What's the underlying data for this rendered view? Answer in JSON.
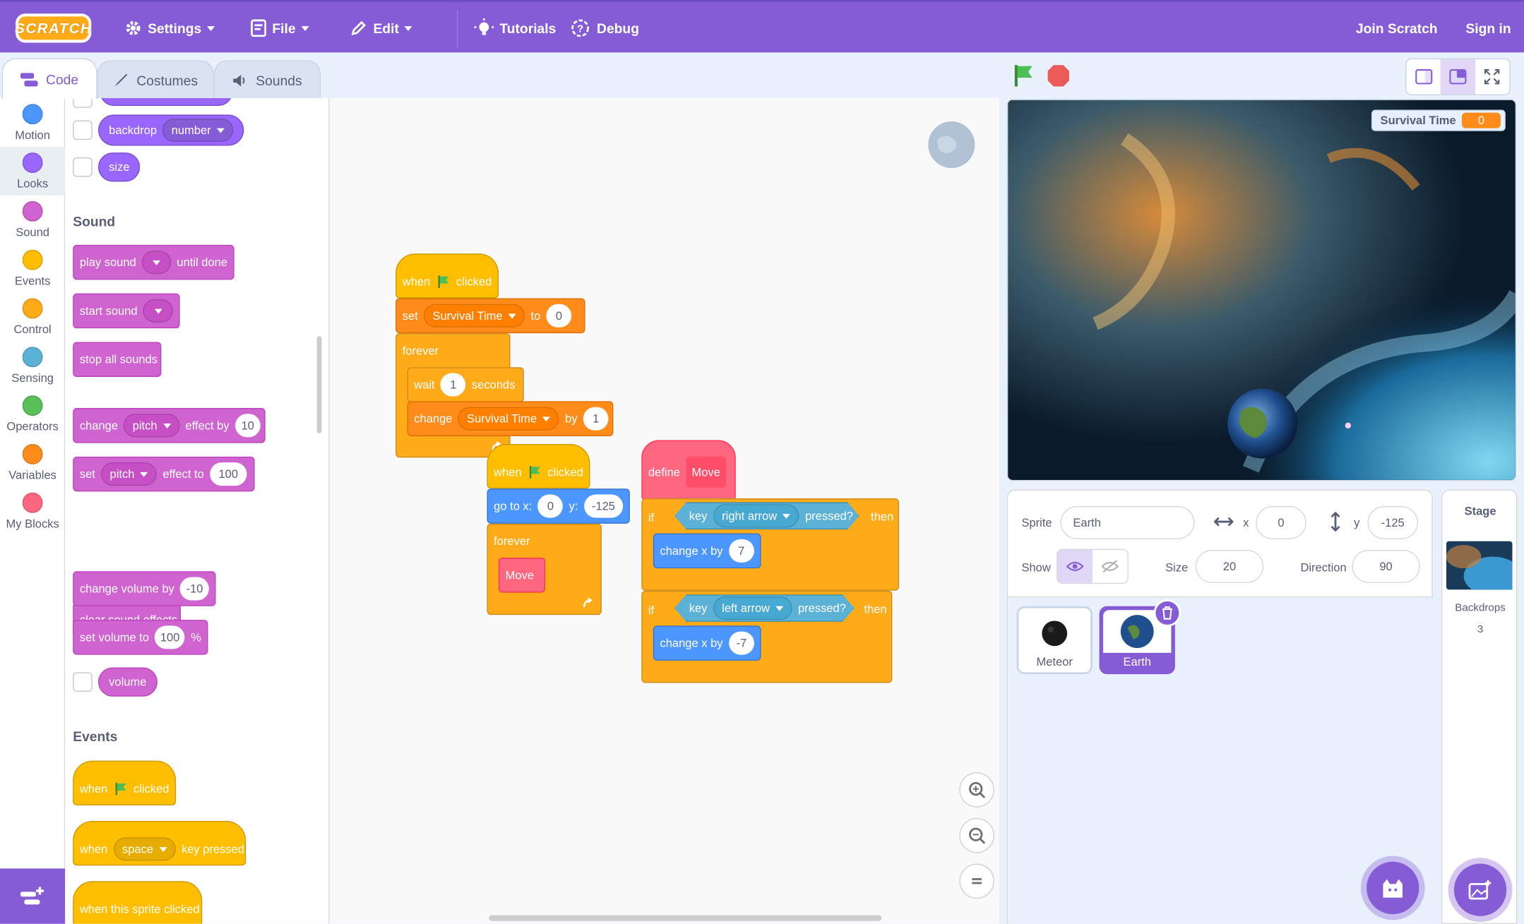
{
  "menu": {
    "logo": "SCRATCH",
    "settings": "Settings",
    "file": "File",
    "edit": "Edit",
    "tutorials": "Tutorials",
    "debug": "Debug",
    "join": "Join Scratch",
    "signin": "Sign in",
    "color": "#855cd6"
  },
  "tabs": {
    "code": "Code",
    "costumes": "Costumes",
    "sounds": "Sounds"
  },
  "categories": [
    {
      "label": "Motion",
      "color": "#4c97ff"
    },
    {
      "label": "Looks",
      "color": "#9966ff"
    },
    {
      "label": "Sound",
      "color": "#cf63cf"
    },
    {
      "label": "Events",
      "color": "#ffbf00"
    },
    {
      "label": "Control",
      "color": "#ffab19"
    },
    {
      "label": "Sensing",
      "color": "#5cb1d6"
    },
    {
      "label": "Operators",
      "color": "#59c059"
    },
    {
      "label": "Variables",
      "color": "#ff8c1a"
    },
    {
      "label": "My Blocks",
      "color": "#ff6680"
    }
  ],
  "palette": {
    "looks": {
      "backdrop": "backdrop",
      "backdrop_opt": "number",
      "size": "size"
    },
    "sound_header": "Sound",
    "play_sound": "play sound",
    "until_done": "until done",
    "start_sound": "start sound",
    "stop_all": "stop all sounds",
    "change": "change",
    "pitch": "pitch",
    "effect_by": "effect by",
    "effect_by_val": "10",
    "set": "set",
    "effect_to": "effect to",
    "effect_to_val": "100",
    "clear_effects": "clear sound effects",
    "change_volume": "change volume by",
    "change_volume_val": "-10",
    "set_volume": "set volume to",
    "set_volume_val": "100",
    "percent": "%",
    "volume": "volume",
    "events_header": "Events",
    "when": "when",
    "clicked": "clicked",
    "space": "space",
    "key_pressed": "key pressed",
    "when_sprite_clicked": "when this sprite clicked"
  },
  "script1": {
    "when": "when",
    "clicked": "clicked",
    "set": "set",
    "var": "Survival Time",
    "to": "to",
    "to_val": "0",
    "forever": "forever",
    "wait": "wait",
    "wait_val": "1",
    "seconds": "seconds",
    "change": "change",
    "by": "by",
    "by_val": "1"
  },
  "script2": {
    "when": "when",
    "clicked": "clicked",
    "goto_x": "go to x:",
    "x_val": "0",
    "y": "y:",
    "y_val": "-125",
    "forever": "forever",
    "move": "Move"
  },
  "script3": {
    "define": "define",
    "move": "Move",
    "if": "if",
    "key": "key",
    "right_arrow": "right arrow",
    "pressed": "pressed?",
    "then": "then",
    "change_x": "change x by",
    "change_x_val1": "7",
    "left_arrow": "left arrow",
    "change_x_val2": "-7"
  },
  "stage": {
    "monitor_label": "Survival Time",
    "monitor_value": "0"
  },
  "sprite_info": {
    "sprite_label": "Sprite",
    "sprite_name": "Earth",
    "x_label": "x",
    "x_val": "0",
    "y_label": "y",
    "y_val": "-125",
    "show_label": "Show",
    "size_label": "Size",
    "size_val": "20",
    "direction_label": "Direction",
    "direction_val": "90"
  },
  "sprites": [
    {
      "name": "Meteor"
    },
    {
      "name": "Earth"
    }
  ],
  "stage_pane": {
    "title": "Stage",
    "backdrops_label": "Backdrops",
    "backdrops_count": "3"
  }
}
